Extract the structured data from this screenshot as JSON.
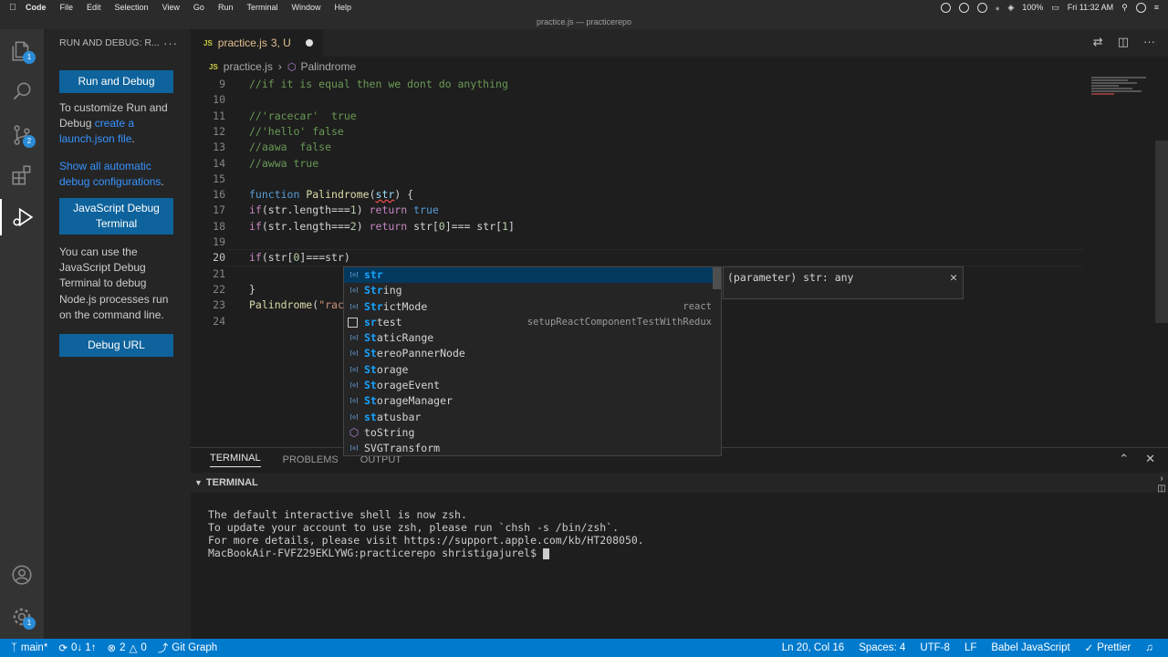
{
  "menubar": {
    "app": "Code",
    "items": [
      "File",
      "Edit",
      "Selection",
      "View",
      "Go",
      "Run",
      "Terminal",
      "Window",
      "Help"
    ],
    "battery": "100%",
    "clock": "Fri 11:32 AM"
  },
  "window_title": "practice.js — practicerepo",
  "activity": {
    "explorer_badge": "1",
    "scm_badge": "2",
    "settings_badge": "1"
  },
  "sidebar": {
    "header": "RUN AND DEBUG: R...",
    "run_debug_button": "Run and Debug",
    "p1_text": "To customize Run and Debug ",
    "p1_link": "create a launch.json file",
    "p1_end": ".",
    "p2_link": "Show all automatic debug configurations",
    "p2_end": ".",
    "js_debug_button": "JavaScript Debug Terminal",
    "p3_text": "You can use the JavaScript Debug Terminal to debug Node.js processes run on the command line.",
    "debug_url_button": "Debug URL"
  },
  "tab": {
    "icon": "JS",
    "name": "practice.js",
    "status": "3, U"
  },
  "breadcrumb": {
    "file_icon": "JS",
    "file": "practice.js",
    "symbol": "Palindrome"
  },
  "editor": {
    "lines": [
      {
        "n": "9"
      },
      {
        "n": "10"
      },
      {
        "n": "11"
      },
      {
        "n": "12"
      },
      {
        "n": "13"
      },
      {
        "n": "14"
      },
      {
        "n": "15"
      },
      {
        "n": "16"
      },
      {
        "n": "17"
      },
      {
        "n": "18"
      },
      {
        "n": "19"
      },
      {
        "n": "20"
      },
      {
        "n": "21"
      },
      {
        "n": "22"
      },
      {
        "n": "23"
      },
      {
        "n": "24"
      }
    ],
    "code": {
      "l9": "//if it is equal then we dont do anything",
      "l11": "//'racecar'  true",
      "l12": "//'hello' false",
      "l13": "//aawa  false",
      "l14": "//awwa true",
      "l16_kw": "function",
      "l16_fn": "Palindrome",
      "l16_open": "(",
      "l16_param": "str",
      "l16_close": ") {",
      "l17_if": "if",
      "l17_cond": "(str.length===",
      "l17_num": "1",
      "l17_close": ")",
      "l17_ret": "return",
      "l17_val": "true",
      "l18_if": "if",
      "l18_cond": "(str.length===",
      "l18_num": "2",
      "l18_close": ")",
      "l18_ret": "return",
      "l18_rest_a": "str[",
      "l18_n0": "0",
      "l18_rest_b": "]=== str[",
      "l18_n1": "1",
      "l18_rest_c": "]",
      "l20_if": "if",
      "l20_a": "(str[",
      "l20_n0": "0",
      "l20_b": "]===str)",
      "l22": "}",
      "l23_fn": "Palindrome",
      "l23_rest": "(",
      "l23_str": "\"rac"
    }
  },
  "suggest": {
    "items": [
      {
        "hl": "str",
        "rest": "",
        "detail": "",
        "kind": "var"
      },
      {
        "hl": "Str",
        "rest": "ing",
        "detail": "",
        "kind": "var"
      },
      {
        "hl": "Str",
        "rest": "ictMode",
        "detail": "react",
        "kind": "var"
      },
      {
        "hl": "sr",
        "rest": "test",
        "detail": "setupReactComponentTestWithRedux",
        "kind": "snippet"
      },
      {
        "hl": "St",
        "rest": "aticRange",
        "detail": "",
        "kind": "var"
      },
      {
        "hl": "St",
        "rest": "ereoPannerNode",
        "detail": "",
        "kind": "var"
      },
      {
        "hl": "St",
        "rest": "orage",
        "detail": "",
        "kind": "var"
      },
      {
        "hl": "St",
        "rest": "orageEvent",
        "detail": "",
        "kind": "var"
      },
      {
        "hl": "St",
        "rest": "orageManager",
        "detail": "",
        "kind": "var"
      },
      {
        "hl": "st",
        "rest": "atusbar",
        "detail": "",
        "kind": "var"
      },
      {
        "hl": "",
        "rest": "toString",
        "detail": "",
        "kind": "method"
      },
      {
        "hl": "",
        "rest": "SVGTransform",
        "detail": "",
        "kind": "var"
      }
    ],
    "details_text": "(parameter) str: any"
  },
  "panel": {
    "tab_terminal": "TERMINAL",
    "tab_problems": "PROBLEMS",
    "tab_output": "OUTPUT",
    "terminal_header": "TERMINAL",
    "out1": "The default interactive shell is now zsh.",
    "out2": "To update your account to use zsh, please run `chsh -s /bin/zsh`.",
    "out3": "For more details, please visit https://support.apple.com/kb/HT208050.",
    "prompt": "MacBookAir-FVFZ29EKLYWG:practicerepo shristigajurel$ "
  },
  "status": {
    "branch": "main*",
    "sync": "0↓ 1↑",
    "errors": "2",
    "warnings": "0",
    "git_graph": "Git Graph",
    "position": "Ln 20, Col 16",
    "spaces": "Spaces: 4",
    "encoding": "UTF-8",
    "eol": "LF",
    "language": "Babel JavaScript",
    "prettier": "Prettier"
  },
  "colors": {
    "accent": "#007acc",
    "button": "#0e639c",
    "link": "#3794ff",
    "modified_tab": "#e2c08d"
  }
}
